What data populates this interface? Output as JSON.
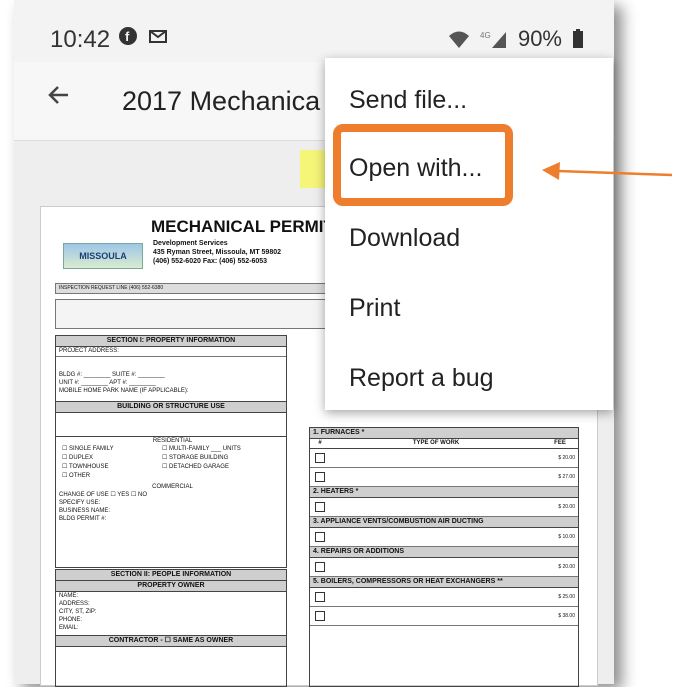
{
  "status": {
    "time": "10:42",
    "battery": "90%",
    "icons_left": [
      "facebook-icon",
      "mail-icon"
    ],
    "icons_right": [
      "wifi-icon",
      "signal-icon",
      "battery-icon"
    ]
  },
  "appbar": {
    "back_icon": "arrow-back-icon",
    "title": "2017 Mechanica"
  },
  "menu": {
    "items": [
      {
        "label": "Send file..."
      },
      {
        "label": "Open with..."
      },
      {
        "label": "Download"
      },
      {
        "label": "Print"
      },
      {
        "label": "Report a bug"
      }
    ]
  },
  "annotation": {
    "highlight_color": "#f5f56a",
    "box_color": "#ef7d2e",
    "arrow_color": "#ef7d2e"
  },
  "document": {
    "heading": "MECHANICAL PERMIT",
    "logo_text": "MISSOULA",
    "dept": "Development Services",
    "address": "435 Ryman Street, Missoula, MT 59802",
    "phone": "(406) 552-6020  Fax: (406) 552-6053",
    "inspection_line": "INSPECTION REQUEST LINE (406) 552-6380",
    "section1": "SECTION I: PROPERTY INFORMATION",
    "project_address": "PROJECT ADDRESS:",
    "bldg": "BLDG #:",
    "suite": "SUITE #:",
    "unit": "UNIT #:",
    "apt": "APT #:",
    "mobile_home": "MOBILE HOME PARK NAME (IF APPLICABLE):",
    "building_use": "BUILDING OR STRUCTURE USE",
    "residential": "RESIDENTIAL",
    "res_options": [
      "SINGLE FAMILY",
      "DUPLEX",
      "TOWNHOUSE",
      "OTHER",
      "MULTI-FAMILY",
      "STORAGE BUILDING",
      "DETACHED GARAGE"
    ],
    "units": "UNITS",
    "commercial": "COMMERCIAL",
    "change_of_use": "CHANGE OF USE",
    "yes": "YES",
    "no": "NO",
    "specify_use": "SPECIFY USE:",
    "business_name": "BUSINESS NAME:",
    "bldg_permit": "BLDG PERMIT #:",
    "section2": "SECTION II: PEOPLE INFORMATION",
    "property_owner": "PROPERTY OWNER",
    "owner_fields": [
      "NAME:",
      "ADDRESS:",
      "CITY, ST, ZIP:",
      "PHONE:",
      "EMAIL:"
    ],
    "contractor": "CONTRACTOR -",
    "same_as_owner": "SAME AS OWNER",
    "right_sections": [
      "1. FURNACES *",
      "2. HEATERS *",
      "3. APPLIANCE VENTS/COMBUSTION AIR DUCTING",
      "4. REPAIRS OR ADDITIONS",
      "5. BOILERS, COMPRESSORS OR HEAT EXCHANGERS **"
    ],
    "type_of_work": "TYPE OF WORK",
    "fee": "FEE",
    "fees": [
      "$ 20.00",
      "$ 27.00",
      "$ 20.00",
      "$ 10.00",
      "$ 20.00",
      "$ 25.00",
      "$ 38.00"
    ]
  }
}
